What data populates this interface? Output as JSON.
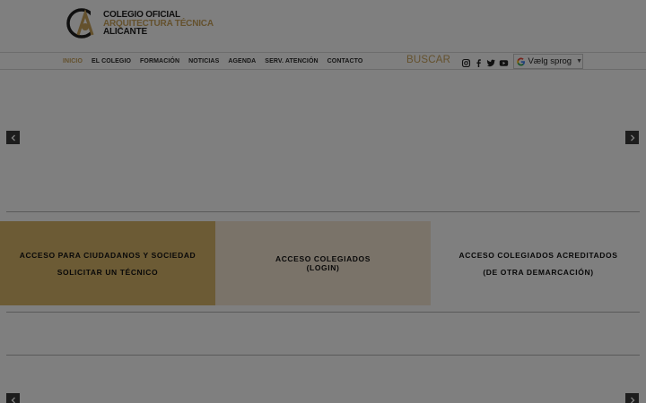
{
  "header": {
    "logo": {
      "initials": "CA",
      "line1": "COLEGIO OFICIAL",
      "line2": "ARQUITECTURA TÉCNICA",
      "line3": "ALICANTE"
    }
  },
  "nav": {
    "items": [
      {
        "label": "INICIO",
        "active": true
      },
      {
        "label": "EL COLEGIO",
        "active": false
      },
      {
        "label": "FORMACIÓN",
        "active": false
      },
      {
        "label": "NOTICIAS",
        "active": false
      },
      {
        "label": "AGENDA",
        "active": false
      },
      {
        "label": "SERV. ATENCIÓN",
        "active": false
      },
      {
        "label": "CONTACTO",
        "active": false
      }
    ],
    "search_label": "BUSCAR",
    "social_icons": [
      "instagram-icon",
      "facebook-icon",
      "twitter-icon",
      "youtube-icon"
    ],
    "language": {
      "label": "Vælg sprog",
      "icon": "google-g-icon"
    }
  },
  "tiles": [
    {
      "lines": [
        "ACCESO PARA CIUDADANOS Y SOCIEDAD",
        "SOLICITAR UN TÉCNICO"
      ]
    },
    {
      "lines": [
        "ACCESO COLEGIADOS",
        "(LOGIN)"
      ]
    },
    {
      "lines": [
        "ACCESO COLEGIADOS ACREDITADOS",
        "(DE OTRA DEMARCACIÓN)"
      ]
    }
  ],
  "colors": {
    "accent": "#c9a25a",
    "tile_gold": "#d9b66b",
    "tile_cream": "#f5e7d3",
    "overlay": "rgba(0,0,0,0.5)"
  }
}
